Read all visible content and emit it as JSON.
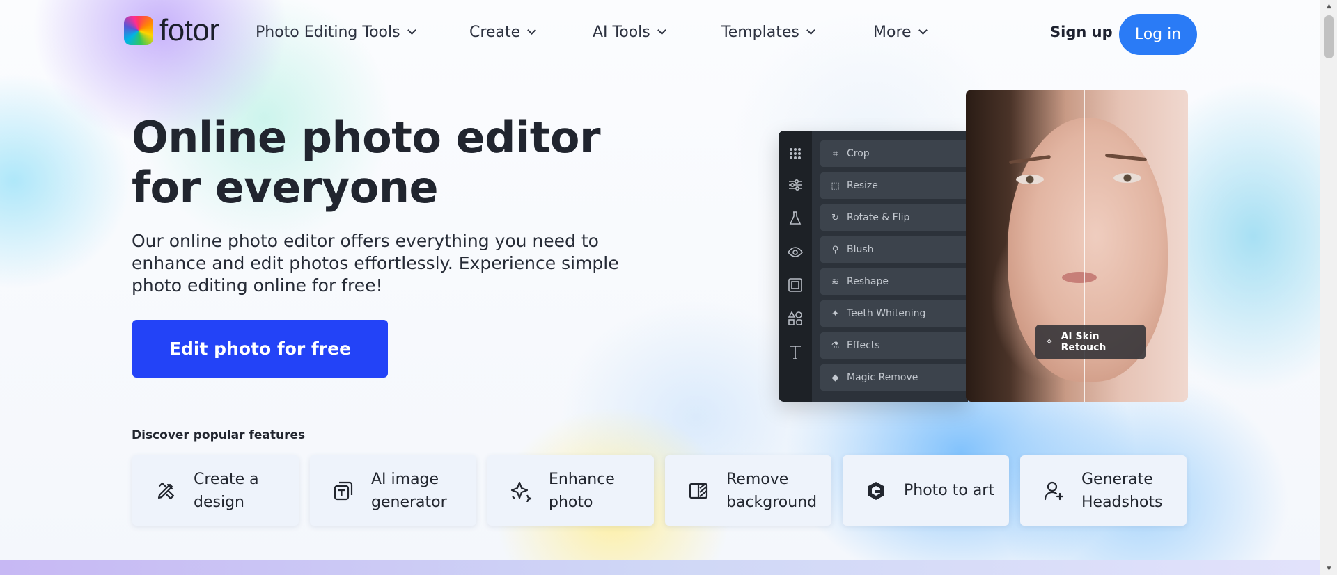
{
  "brand": {
    "name": "fotor"
  },
  "nav": {
    "items": [
      {
        "label": "Photo Editing Tools"
      },
      {
        "label": "Create"
      },
      {
        "label": "AI Tools"
      },
      {
        "label": "Templates"
      },
      {
        "label": "More"
      }
    ],
    "signup_label": "Sign up",
    "login_label": "Log in"
  },
  "hero": {
    "title": "Online photo editor for everyone",
    "subtitle": "Our online photo editor offers everything you need to enhance and edit photos effortlessly. Experience simple photo editing online for free!",
    "cta_label": "Edit photo for free"
  },
  "editor": {
    "rail_icons": [
      "grid-icon",
      "sliders-icon",
      "flask-icon",
      "eye-icon",
      "frame-icon",
      "shapes-icon",
      "text-icon"
    ],
    "tools": [
      {
        "label": "Crop",
        "icon": "crop-icon"
      },
      {
        "label": "Resize",
        "icon": "resize-icon"
      },
      {
        "label": "Rotate & Flip",
        "icon": "rotate-icon"
      },
      {
        "label": "Blush",
        "icon": "blush-icon"
      },
      {
        "label": "Reshape",
        "icon": "reshape-icon"
      },
      {
        "label": "Teeth Whitening",
        "icon": "tooth-icon"
      },
      {
        "label": "Effects",
        "icon": "flask-icon"
      },
      {
        "label": "Magic Remove",
        "icon": "eraser-icon"
      }
    ],
    "ai_badge_label": "AI Skin Retouch"
  },
  "features": {
    "title": "Discover popular features",
    "items": [
      {
        "label": "Create a design",
        "icon": "pencil-ruler-icon"
      },
      {
        "label": "AI image generator",
        "icon": "ai-image-icon"
      },
      {
        "label": "Enhance photo",
        "icon": "sparkle-icon"
      },
      {
        "label": "Remove background",
        "icon": "remove-bg-icon"
      },
      {
        "label": "Photo to art",
        "icon": "art-icon"
      },
      {
        "label": "Generate Headshots",
        "icon": "user-plus-icon"
      }
    ]
  },
  "colors": {
    "primary_blue": "#2343f7",
    "login_blue": "#2a7bf6",
    "text_dark": "#21252f"
  }
}
